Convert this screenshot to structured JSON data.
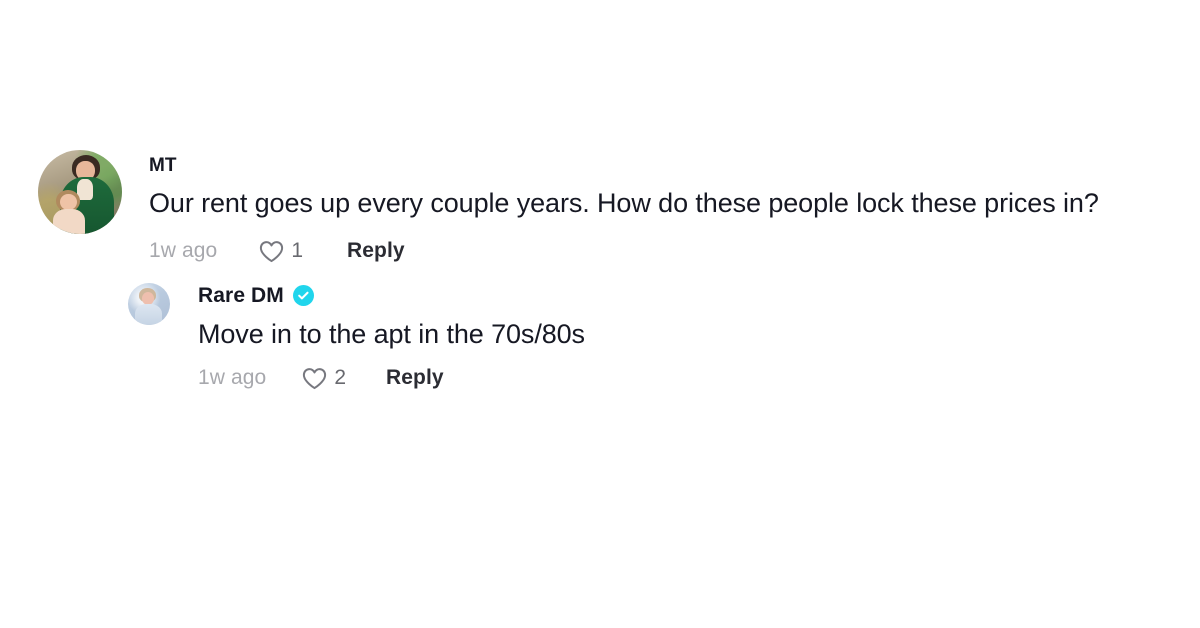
{
  "page": {
    "background": "#ffffff",
    "text_color": "#161823",
    "muted_color": "#a7a8ad",
    "verified_badge_color": "#20d5ec"
  },
  "comment": {
    "avatar": {
      "icon": "user-avatar-photo",
      "alt": "woman in green cardigan holding a toddler"
    },
    "username": "MT",
    "text": "Our rent goes up every couple years. How do these people lock these prices in?",
    "timestamp": "1w ago",
    "like_icon": "heart-outline-icon",
    "like_count": "1",
    "reply_label": "Reply"
  },
  "reply": {
    "avatar": {
      "icon": "user-avatar-photo",
      "alt": "pale blue portrait avatar"
    },
    "username": "Rare DM",
    "verified": true,
    "verified_icon": "verified-check-icon",
    "text": "Move in to the apt in the 70s/80s",
    "timestamp": "1w ago",
    "like_icon": "heart-outline-icon",
    "like_count": "2",
    "reply_label": "Reply"
  }
}
